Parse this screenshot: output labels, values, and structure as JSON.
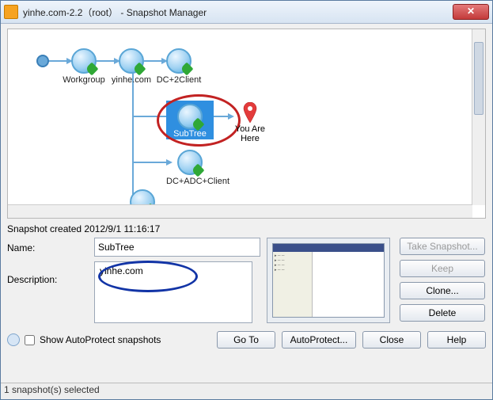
{
  "window": {
    "title": "yinhe.com-2.2（root） - Snapshot Manager",
    "close": "✕"
  },
  "tree": {
    "workgroup": "Workgroup",
    "yinhe": "yinhe.com",
    "dc2client": "DC+2Client",
    "subtree": "SubTree",
    "you_are_here": "You Are Here",
    "dc_adc_client": "DC+ADC+Client"
  },
  "details": {
    "created_label": "Snapshot created 2012/9/1 11:16:17",
    "name_label": "Name:",
    "name_value": "SubTree",
    "description_label": "Description:",
    "description_value": "yinhe.com"
  },
  "buttons": {
    "take_snapshot": "Take Snapshot...",
    "keep": "Keep",
    "clone": "Clone...",
    "delete": "Delete",
    "go_to": "Go To",
    "auto_protect": "AutoProtect...",
    "close": "Close",
    "help": "Help"
  },
  "footer": {
    "show_autoprotect": "Show AutoProtect snapshots",
    "status": "1 snapshot(s) selected"
  }
}
